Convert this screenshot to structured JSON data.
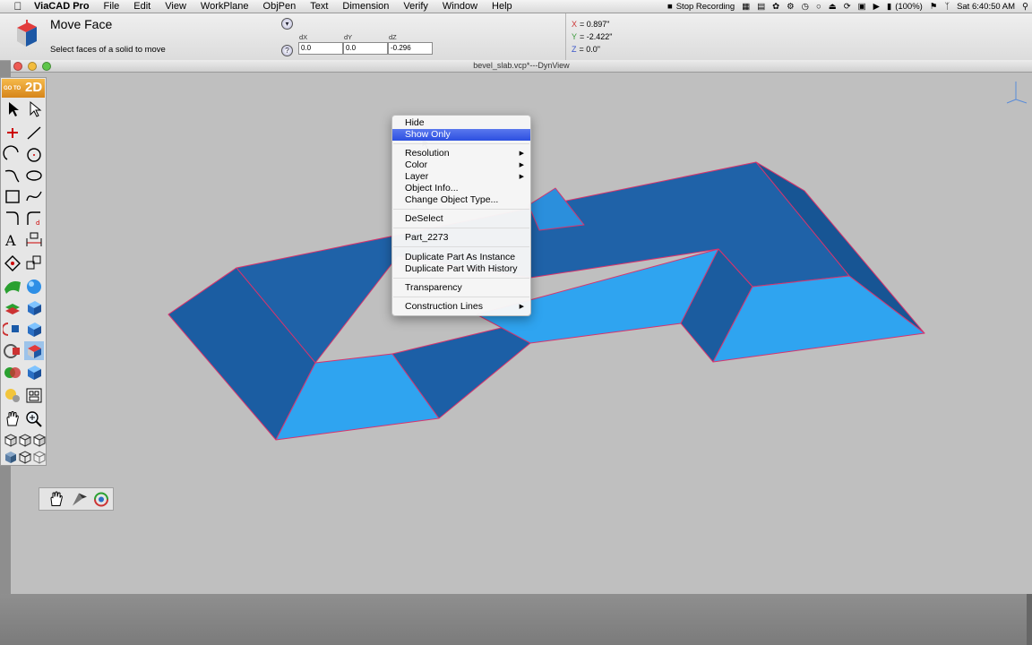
{
  "menubar": {
    "app": "ViaCAD Pro",
    "items": [
      "File",
      "Edit",
      "View",
      "WorkPlane",
      "ObjPen",
      "Text",
      "Dimension",
      "Verify",
      "Window",
      "Help"
    ],
    "status": {
      "recording": "Stop Recording",
      "battery": "(100%)",
      "clock": "Sat 6:40:50 AM"
    }
  },
  "tool": {
    "title": "Move Face",
    "hint": "Select faces of a solid to move",
    "fields": [
      {
        "label": "dX",
        "value": "0.0"
      },
      {
        "label": "dY",
        "value": "0.0"
      },
      {
        "label": "dZ",
        "value": "-0.296"
      }
    ],
    "coords": {
      "x_label": "X",
      "x": "= 0.897\"",
      "y_label": "Y",
      "y": "= -2.422\"",
      "z_label": "Z",
      "z": "= 0.0\""
    }
  },
  "window": {
    "title": "bevel_slab.vcp*---DynView"
  },
  "palette": {
    "goto_small": "GO TO",
    "goto_big": "2D"
  },
  "context_menu": {
    "items": [
      {
        "label": "Hide"
      },
      {
        "label": "Show Only",
        "selected": true
      },
      {
        "label": "Resolution",
        "submenu": true
      },
      {
        "label": "Color",
        "submenu": true
      },
      {
        "label": "Layer",
        "submenu": true
      },
      {
        "label": "Object Info..."
      },
      {
        "label": "Change Object Type..."
      },
      {
        "label": "DeSelect"
      },
      {
        "label": "Part_2273"
      },
      {
        "label": "Duplicate Part As Instance"
      },
      {
        "label": "Duplicate Part With History"
      },
      {
        "label": "Transparency"
      },
      {
        "label": "Construction Lines",
        "submenu": true
      }
    ]
  },
  "colors": {
    "viewport_bg": "#bfbfbf",
    "face_dark": "#1f63a8",
    "face_light": "#2fa4f0",
    "edge_highlight": "#e0306a",
    "menu_selection": "#3458e4"
  }
}
